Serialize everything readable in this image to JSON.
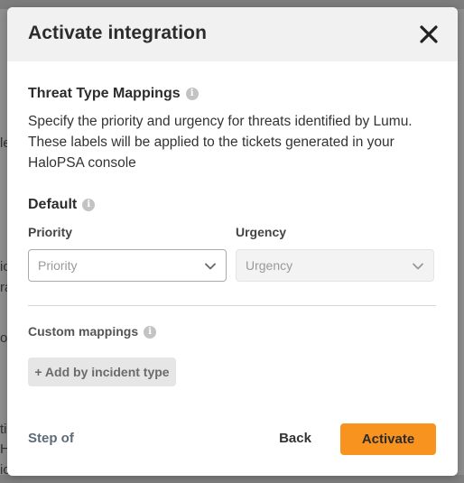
{
  "background": {
    "fragments": [
      "le",
      "ic",
      "ra",
      "oy",
      "ti",
      "H",
      "ic",
      "ol"
    ]
  },
  "modal": {
    "title": "Activate integration",
    "close_icon": "close-icon",
    "section_title": "Threat Type Mappings",
    "description": "Specify the priority and urgency for threats identified by Lumu. These labels will be applied to the tickets generated in your HaloPSA console",
    "default_title": "Default",
    "priority": {
      "label": "Priority",
      "placeholder": "Priority"
    },
    "urgency": {
      "label": "Urgency",
      "placeholder": "Urgency"
    },
    "custom_mappings_label": "Custom mappings",
    "add_button_label": "+ Add by incident type",
    "step_text": "Step of",
    "back_label": "Back",
    "activate_label": "Activate",
    "colors": {
      "accent": "#f7931e",
      "header_bg": "#f1f1f1"
    }
  }
}
